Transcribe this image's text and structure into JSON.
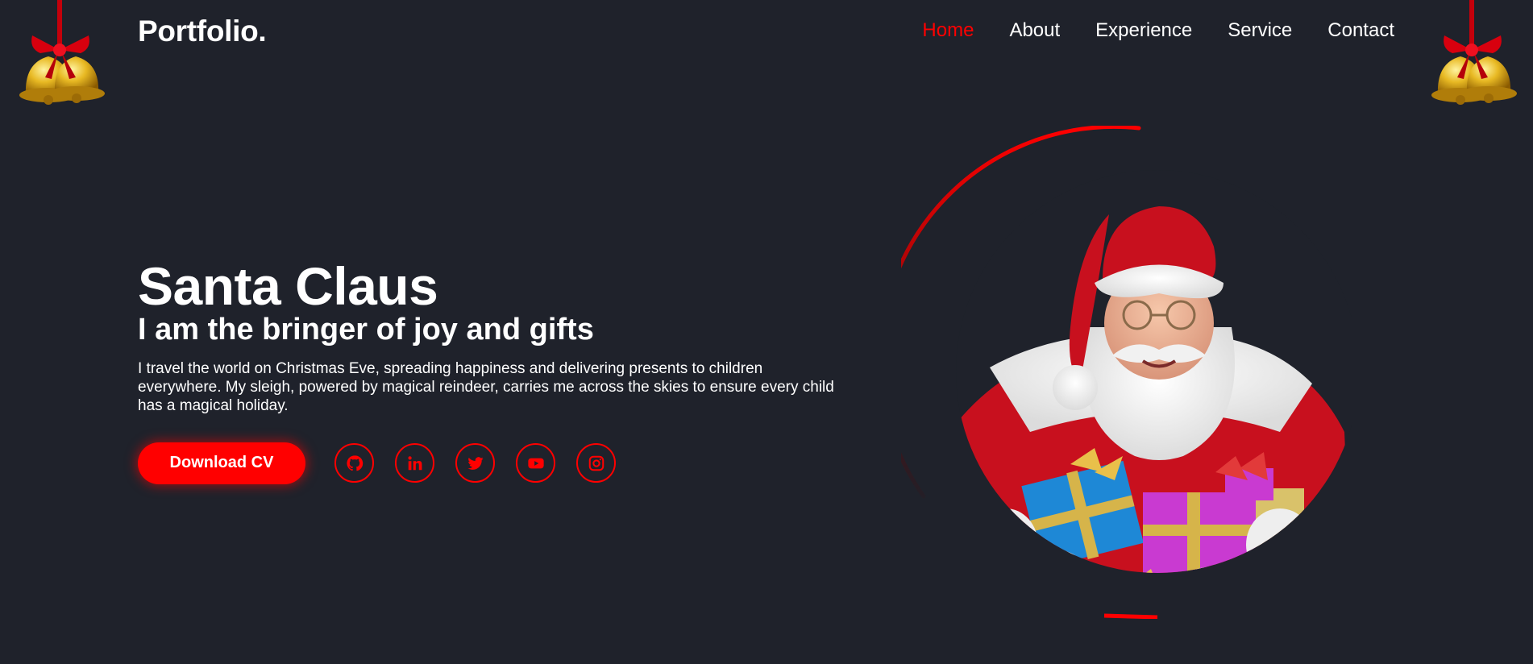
{
  "header": {
    "logo": "Portfolio.",
    "nav": [
      {
        "label": "Home",
        "active": true
      },
      {
        "label": "About",
        "active": false
      },
      {
        "label": "Experience",
        "active": false
      },
      {
        "label": "Service",
        "active": false
      },
      {
        "label": "Contact",
        "active": false
      }
    ]
  },
  "hero": {
    "name": "Santa Claus",
    "tagline": "I am the bringer of joy and gifts",
    "description": "I travel the world on Christmas Eve, spreading happiness and delivering presents to children everywhere. My sleigh, powered by magical reindeer, carries me across the skies to ensure every child has a magical holiday.",
    "cta_label": "Download CV",
    "socials": [
      {
        "name": "github-icon"
      },
      {
        "name": "linkedin-icon"
      },
      {
        "name": "twitter-icon"
      },
      {
        "name": "youtube-icon"
      },
      {
        "name": "instagram-icon"
      }
    ]
  },
  "decor": {
    "left_icon": "christmas-bells-icon",
    "right_icon": "christmas-bells-icon",
    "portrait": "santa-portrait-image"
  },
  "colors": {
    "background": "#1f222b",
    "accent": "#ff0000",
    "text": "#ffffff"
  }
}
